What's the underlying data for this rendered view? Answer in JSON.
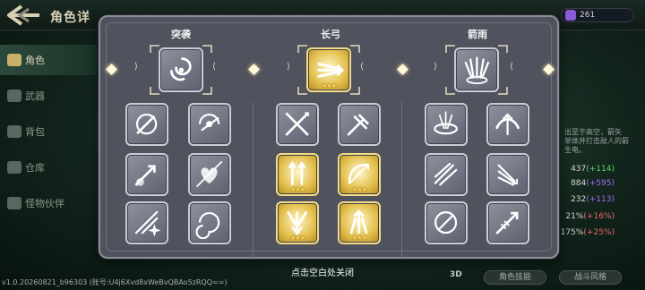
{
  "header": {
    "title": "角色详",
    "currency_value": "261"
  },
  "sidebar": {
    "items": [
      {
        "label": "角色",
        "active": true
      },
      {
        "label": "武器",
        "active": false
      },
      {
        "label": "背包",
        "active": false
      },
      {
        "label": "仓库",
        "active": false
      },
      {
        "label": "怪物伙伴",
        "active": false
      }
    ]
  },
  "right_panel": {
    "desc_lines": [
      "出至于高空，箭矢",
      "单体并打击敌人的箭",
      "生电。"
    ],
    "stats": [
      {
        "value": "437",
        "bonus": "(+114)",
        "color": "up"
      },
      {
        "value": "884",
        "bonus": "(+595)",
        "color": "purple"
      },
      {
        "value": "232",
        "bonus": "(+113)",
        "color": "purple"
      },
      {
        "value": "21%",
        "bonus": "(+16%)",
        "color": "red"
      },
      {
        "value": "175%",
        "bonus": "(+25%)",
        "color": "red"
      }
    ],
    "btn_left": "角色技能",
    "btn_right": "战斗风格",
    "label_3d": "3D"
  },
  "version_text": "v1.0.20260821_b96303 (账号:U4j6Xvd8xWeBvQBAo5zRQQ==)",
  "modal": {
    "columns": [
      {
        "title": "突袭",
        "main_skill": {
          "icon": "whirlwind-icon",
          "gold": false,
          "stars": ""
        },
        "skills": [
          {
            "icon": "circle-strike-icon",
            "gold": false,
            "stars": ""
          },
          {
            "icon": "spin-slash-icon",
            "gold": false,
            "stars": ""
          },
          {
            "icon": "burst-arrow-icon",
            "gold": false,
            "stars": ""
          },
          {
            "icon": "heart-arrow-icon",
            "gold": false,
            "stars": ""
          },
          {
            "icon": "sparkle-slash-icon",
            "gold": false,
            "stars": ""
          },
          {
            "icon": "vortex-icon",
            "gold": false,
            "stars": ""
          }
        ]
      },
      {
        "title": "长弓",
        "main_skill": {
          "icon": "multi-arrow-icon",
          "gold": true,
          "stars": "★★★"
        },
        "skills": [
          {
            "icon": "cross-slash-icon",
            "gold": false,
            "stars": ""
          },
          {
            "icon": "impact-icon",
            "gold": false,
            "stars": ""
          },
          {
            "icon": "twin-arrow-icon",
            "gold": true,
            "stars": "★★★"
          },
          {
            "icon": "bow-icon",
            "gold": true,
            "stars": "★★★"
          },
          {
            "icon": "arrow-rain-down-icon",
            "gold": true,
            "stars": "★★★"
          },
          {
            "icon": "arrow-burst-up-icon",
            "gold": true,
            "stars": "★★★"
          }
        ]
      },
      {
        "title": "箭雨",
        "main_skill": {
          "icon": "arrow-storm-icon",
          "gold": false,
          "stars": ""
        },
        "skills": [
          {
            "icon": "arrow-circle-icon",
            "gold": false,
            "stars": ""
          },
          {
            "icon": "bow-up-icon",
            "gold": false,
            "stars": ""
          },
          {
            "icon": "spread-arrows-icon",
            "gold": false,
            "stars": ""
          },
          {
            "icon": "fan-arrows-icon",
            "gold": false,
            "stars": ""
          },
          {
            "icon": "target-arrow-icon",
            "gold": false,
            "stars": ""
          },
          {
            "icon": "long-arrow-icon",
            "gold": false,
            "stars": ""
          }
        ]
      }
    ],
    "close_hint": "点击空白处关闭"
  }
}
